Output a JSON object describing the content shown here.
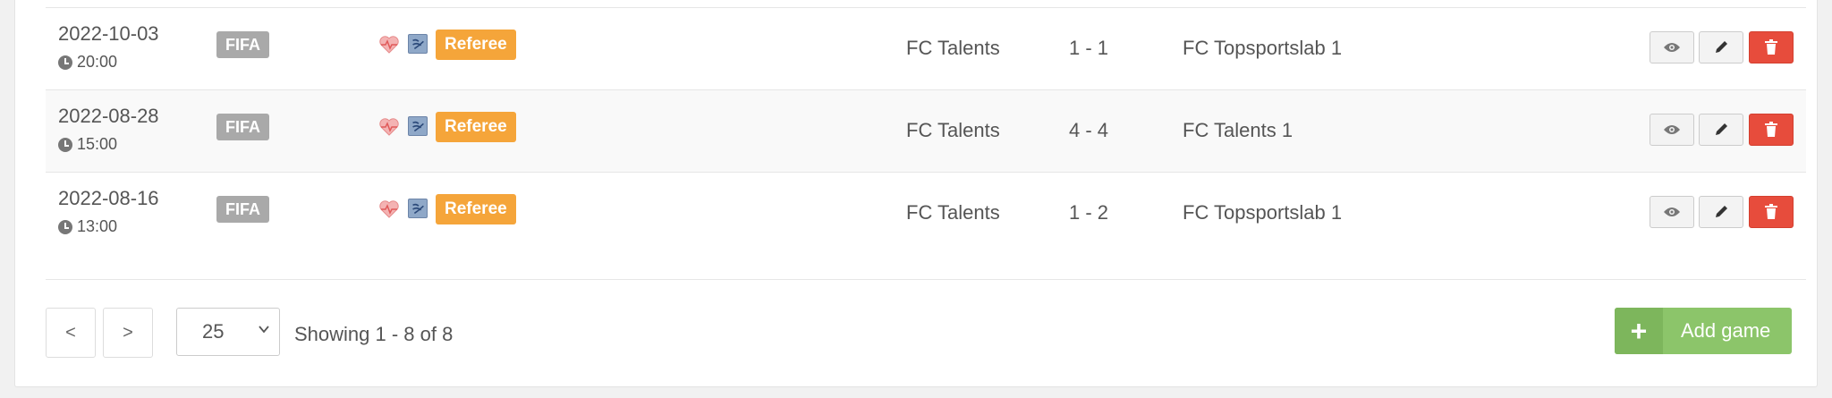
{
  "games": [
    {
      "date": "2022-10-03",
      "time": "20:00",
      "competition": "FIFA",
      "role": "Referee",
      "home": "FC Talents",
      "score": "1 - 1",
      "away": "FC Topsportslab 1"
    },
    {
      "date": "2022-08-28",
      "time": "15:00",
      "competition": "FIFA",
      "role": "Referee",
      "home": "FC Talents",
      "score": "4 - 4",
      "away": "FC Talents 1"
    },
    {
      "date": "2022-08-16",
      "time": "13:00",
      "competition": "FIFA",
      "role": "Referee",
      "home": "FC Talents",
      "score": "1 - 2",
      "away": "FC Topsportslab 1"
    }
  ],
  "pagination": {
    "prev_label": "<",
    "next_label": ">",
    "per_page": "25",
    "showing": "Showing 1 - 8 of 8"
  },
  "actions": {
    "add_game_label": "Add game",
    "add_icon": "+"
  },
  "colors": {
    "delete": "#e74c3c",
    "referee_badge": "#f5a53a",
    "add_button": "#8cc56a"
  }
}
